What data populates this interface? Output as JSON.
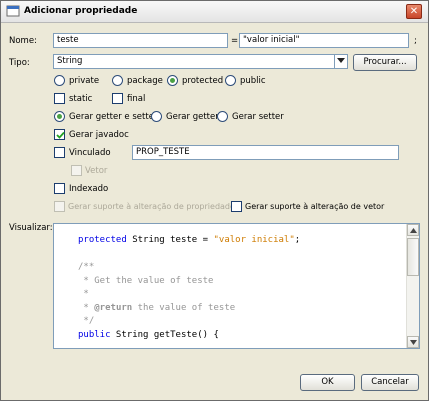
{
  "window": {
    "title": "Adicionar propriedade",
    "close_icon": "close-icon"
  },
  "name": {
    "label": "Nome:",
    "value": "teste",
    "equals": "=",
    "initial_value": "\"valor inicial\"",
    "semicolon": ";"
  },
  "type": {
    "label": "Tipo:",
    "value": "String",
    "browse_label": "Procurar..."
  },
  "access": {
    "options": [
      "private",
      "package",
      "protected",
      "public"
    ],
    "selected": "protected"
  },
  "modifiers": {
    "static_label": "static",
    "final_label": "final"
  },
  "accessors": {
    "options": [
      "Gerar getter e setter",
      "Gerar getter",
      "Gerar setter"
    ],
    "selected": "Gerar getter e setter"
  },
  "javadoc": {
    "label": "Gerar javadoc",
    "checked": true
  },
  "bound": {
    "label": "Vinculado",
    "checked": false,
    "constant_value": "PROP_TESTE",
    "veto_label": "Vetor"
  },
  "indexed": {
    "label": "Indexado",
    "checked": false
  },
  "support": {
    "property_change_label": "Gerar suporte à alteração de propriedade",
    "veto_change_label": "Gerar suporte à alteração de vetor"
  },
  "preview": {
    "label": "Visualizar:",
    "lines": [
      "protected String teste = \"valor inicial\";",
      "",
      "/**",
      " * Get the value of teste",
      " *",
      " * @return the value of teste",
      " */",
      "public String getTeste() {"
    ]
  },
  "footer": {
    "ok_label": "OK",
    "cancel_label": "Cancelar"
  },
  "colors": {
    "keyword": "#0000e6",
    "string": "#ce7b00",
    "comment": "#969696",
    "radio_selected": "#4aa044"
  }
}
